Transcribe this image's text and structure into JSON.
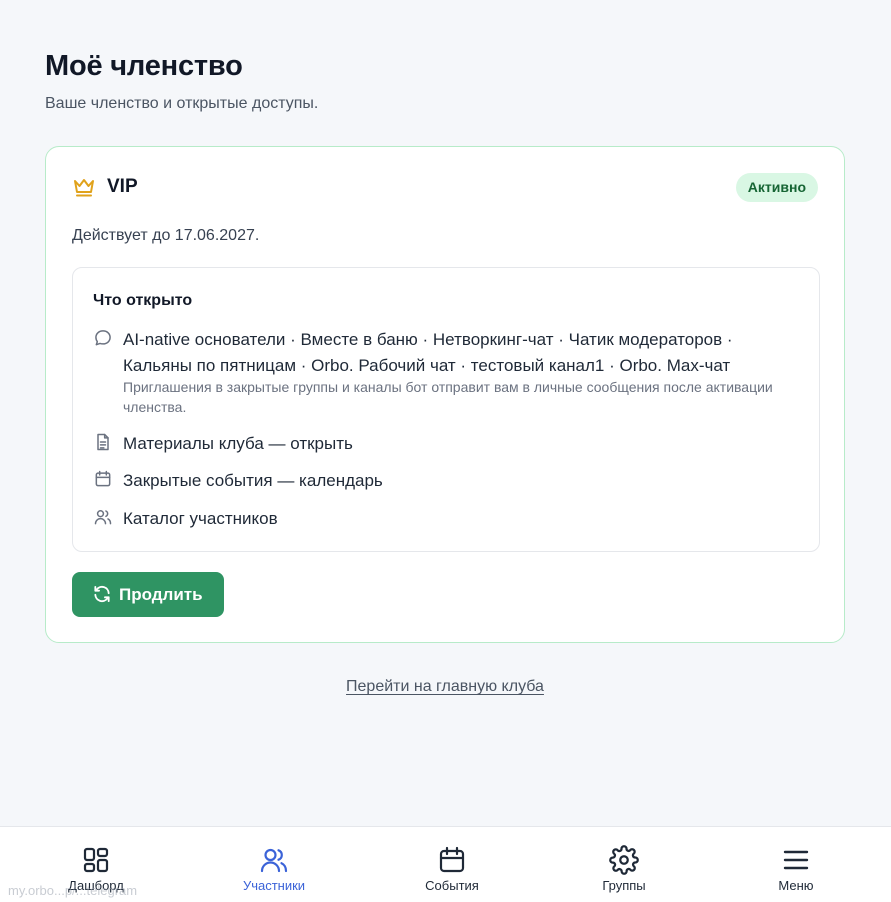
{
  "header": {
    "title": "Моё членство",
    "subtitle": "Ваше членство и открытые доступы."
  },
  "membership": {
    "plan_name": "VIP",
    "plan_icon": "crown-icon",
    "status": "Активно",
    "valid_until": "Действует до 17.06.2027.",
    "access": {
      "title": "Что открыто",
      "groups_text": "AI-native основатели · Вместе в баню · Нетворкинг-чат · Чатик модераторов · Кальяны по пятницам · Orbo. Рабочий чат · тестовый канал1 · Orbo. Max-чат",
      "groups_note": "Приглашения в закрытые группы и каналы бот отправит вам в личные сообщения после активации членства.",
      "materials": "Материалы клуба — открыть",
      "events": "Закрытые события — календарь",
      "members": "Каталог участников"
    },
    "renew_label": "Продлить"
  },
  "home_link": "Перейти на главную клуба",
  "bottom_nav": {
    "items": [
      {
        "label": "Дашборд",
        "icon": "dashboard-icon",
        "active": false
      },
      {
        "label": "Участники",
        "icon": "users-icon",
        "active": true
      },
      {
        "label": "События",
        "icon": "calendar-icon",
        "active": false
      },
      {
        "label": "Группы",
        "icon": "gear-icon",
        "active": false
      },
      {
        "label": "Меню",
        "icon": "menu-icon",
        "active": false
      }
    ]
  },
  "url_hint": "my.orbo...p/...telegram",
  "colors": {
    "accent_green": "#2f9463",
    "active_nav": "#3b63d8",
    "crown": "#e0a21b",
    "badge_bg": "#d9f7e4"
  }
}
